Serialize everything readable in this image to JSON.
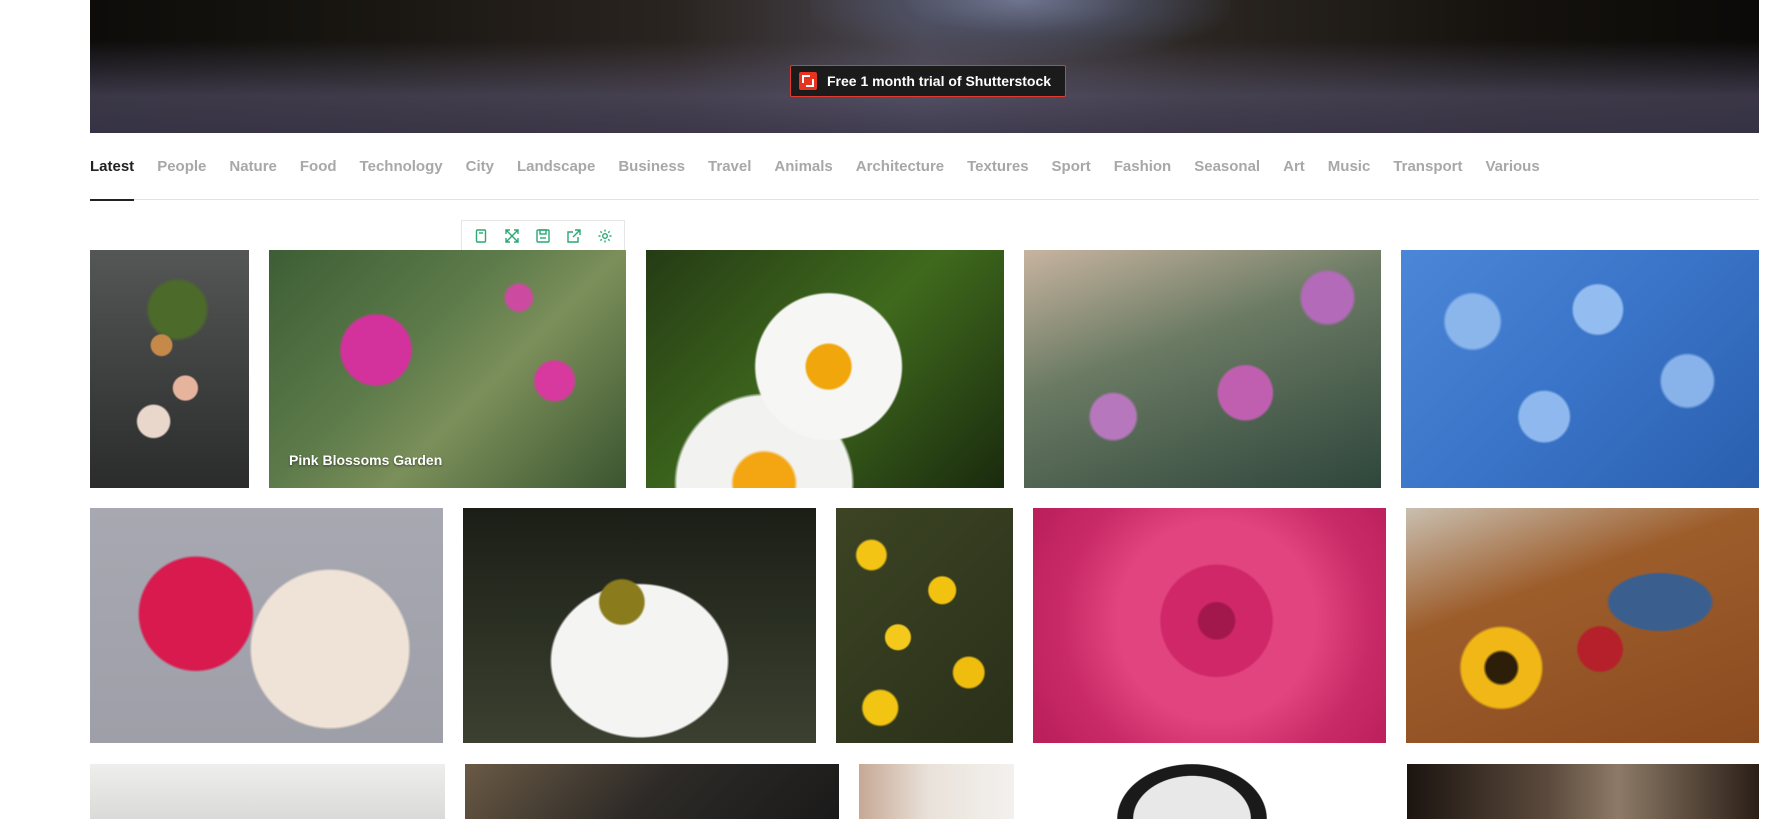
{
  "promo": {
    "label": "Free 1 month trial of Shutterstock",
    "logo_icon": "shutterstock-logo-icon"
  },
  "categories": {
    "active": "Latest",
    "items": [
      "Latest",
      "People",
      "Nature",
      "Food",
      "Technology",
      "City",
      "Landscape",
      "Business",
      "Travel",
      "Animals",
      "Architecture",
      "Textures",
      "Sport",
      "Fashion",
      "Seasonal",
      "Art",
      "Music",
      "Transport",
      "Various"
    ]
  },
  "hover_toolbar": {
    "icons": [
      "bookmark-icon",
      "expand-icon",
      "save-icon",
      "share-icon",
      "settings-icon"
    ]
  },
  "photos": {
    "hovered_caption": "Pink Blossoms Garden"
  },
  "colors": {
    "accent_green": "#2aa774",
    "promo_border": "#e23b2d",
    "promo_logo": "#e8331f",
    "tab_active": "#222222",
    "tab_inactive": "#a8a8a8"
  }
}
